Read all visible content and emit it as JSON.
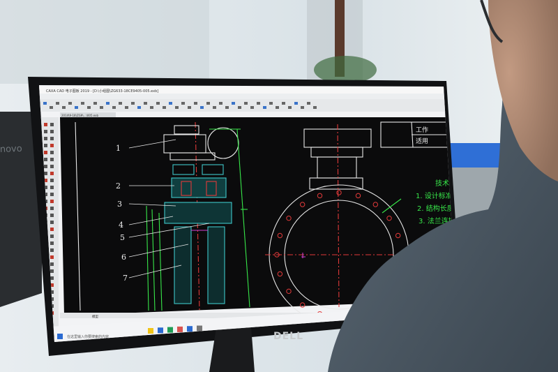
{
  "app": {
    "window_title": "CAXA CAD 电子图板 2019 - [D:\\小组图\\ZG633-18CE9405-005.exb]",
    "doc_tab": "2014\\9-18\\ZG9\\...\\005.exb",
    "model_tab": "模型"
  },
  "drawing": {
    "part_labels": [
      "1",
      "2",
      "3",
      "4",
      "5",
      "6",
      "7"
    ],
    "title_block": [
      "工作",
      "适用"
    ],
    "notes_header": "技术",
    "notes": [
      "1. 设计标准",
      "2. 结构长度",
      "3. 法兰连接"
    ]
  },
  "taskbar": {
    "search_placeholder": "在这里输入你要搜索的内容"
  },
  "monitor": {
    "brand": "DELL",
    "side_brand": "novo"
  },
  "colors": {
    "cad_background": "#0b0b0c",
    "cad_green": "#38e84a",
    "cad_cyan": "#3fc7c9",
    "cad_red": "#e23a3a",
    "cad_magenta": "#d040d0"
  }
}
